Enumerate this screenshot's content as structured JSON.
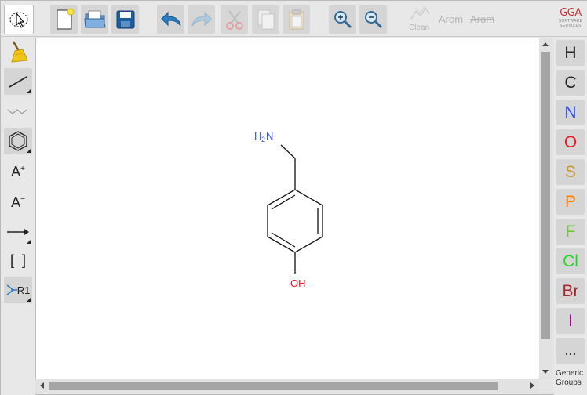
{
  "toolbar": {
    "clean_label": "Clean",
    "arom_label": "Arom",
    "dearom_label": "Arom"
  },
  "logo": {
    "text": "GGA",
    "subtitle_line1": "SOFTWARE",
    "subtitle_line2": "SERVICES"
  },
  "left_tools": {
    "charge_plus": "A",
    "charge_plus_sup": "+",
    "charge_minus": "A",
    "charge_minus_sup": "−",
    "bracket": "[  ]",
    "rgroup": "R1"
  },
  "atoms": [
    {
      "symbol": "H",
      "color": "#222222"
    },
    {
      "symbol": "C",
      "color": "#222222"
    },
    {
      "symbol": "N",
      "color": "#3050F8"
    },
    {
      "symbol": "O",
      "color": "#E8191E"
    },
    {
      "symbol": "S",
      "color": "#C99A2E"
    },
    {
      "symbol": "P",
      "color": "#FF8000"
    },
    {
      "symbol": "F",
      "color": "#6FC63C"
    },
    {
      "symbol": "Cl",
      "color": "#1FDE1F"
    },
    {
      "symbol": "Br",
      "color": "#A62929"
    },
    {
      "symbol": "I",
      "color": "#940094"
    }
  ],
  "more_label": "...",
  "generic_groups": {
    "line1": "Generic",
    "line2": "Groups"
  },
  "molecule": {
    "amine_label": "H",
    "amine_sub": "2",
    "amine_n": "N",
    "hydroxyl_label": "OH",
    "amine_color": "#3050F8",
    "hydroxyl_color": "#E8191E"
  }
}
